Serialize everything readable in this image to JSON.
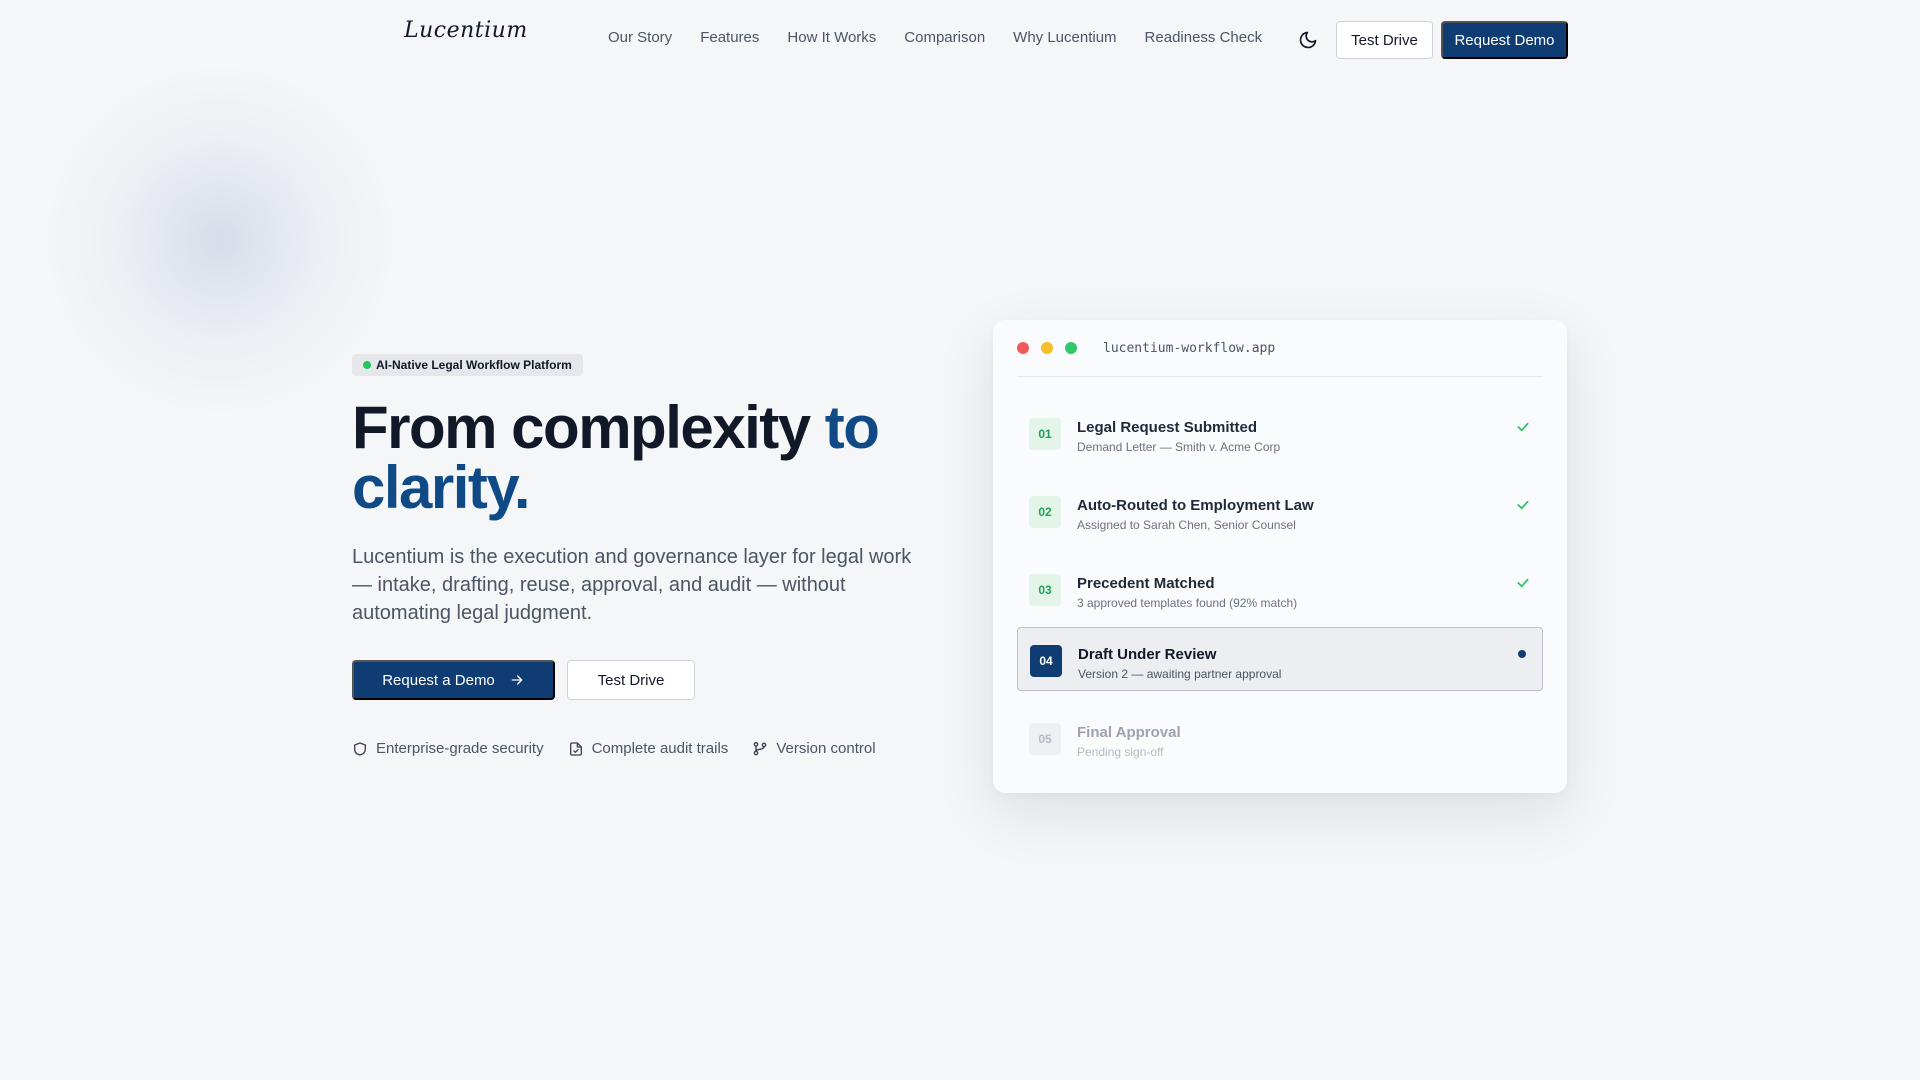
{
  "brand": {
    "logo": "Lucentium"
  },
  "nav": {
    "links": [
      "Our Story",
      "Features",
      "How It Works",
      "Comparison",
      "Why Lucentium",
      "Readiness Check"
    ],
    "theme_toggle_icon": "moon-icon",
    "test_drive_label": "Test Drive",
    "request_demo_label": "Request Demo"
  },
  "hero": {
    "badge": "AI-Native Legal Workflow Platform",
    "headline_part1": "From complexity ",
    "headline_part2": "to clarity.",
    "subtext": "Lucentium is the execution and governance layer for legal work — intake, drafting, reuse, approval, and audit — without automating legal judgment.",
    "primary_cta": "Request a Demo",
    "secondary_cta": "Test Drive",
    "features": [
      {
        "icon": "shield-icon",
        "label": "Enterprise-grade security"
      },
      {
        "icon": "file-check-icon",
        "label": "Complete audit trails"
      },
      {
        "icon": "git-branch-icon",
        "label": "Version control"
      }
    ]
  },
  "workflow": {
    "url": "lucentium-workflow.app",
    "steps": [
      {
        "num": "01",
        "title": "Legal Request Submitted",
        "sub": "Demand Letter — Smith v. Acme Corp",
        "state": "done"
      },
      {
        "num": "02",
        "title": "Auto-Routed to Employment Law",
        "sub": "Assigned to Sarah Chen, Senior Counsel",
        "state": "done"
      },
      {
        "num": "03",
        "title": "Precedent Matched",
        "sub": "3 approved templates found (92% match)",
        "state": "done"
      },
      {
        "num": "04",
        "title": "Draft Under Review",
        "sub": "Version 2 — awaiting partner approval",
        "state": "active"
      },
      {
        "num": "05",
        "title": "Final Approval",
        "sub": "Pending sign-off",
        "state": "pending"
      }
    ]
  },
  "colors": {
    "brand_navy": "#0f3d73",
    "accent_blue": "#0f4a86",
    "success_green": "#22c55e",
    "window_red": "#ef5b5b",
    "window_yellow": "#f5c02a",
    "window_green": "#34c76a"
  }
}
